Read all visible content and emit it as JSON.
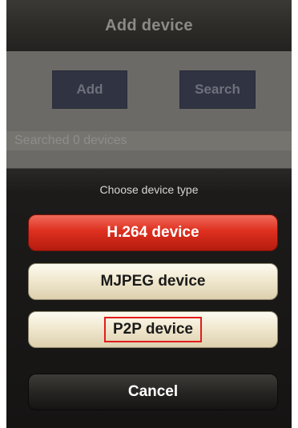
{
  "navbar": {
    "title": "Add device"
  },
  "content": {
    "add_label": "Add",
    "search_label": "Search",
    "status_text": "Searched 0 devices"
  },
  "sheet": {
    "title": "Choose device type",
    "options": [
      {
        "label": "H.264 device"
      },
      {
        "label": "MJPEG device"
      },
      {
        "label": "P2P device",
        "highlighted": true
      }
    ],
    "cancel_label": "Cancel"
  },
  "colors": {
    "destructive": "#de2f1f",
    "highlight_box": "#e21c1c",
    "option_bg": "#efe6cc"
  }
}
